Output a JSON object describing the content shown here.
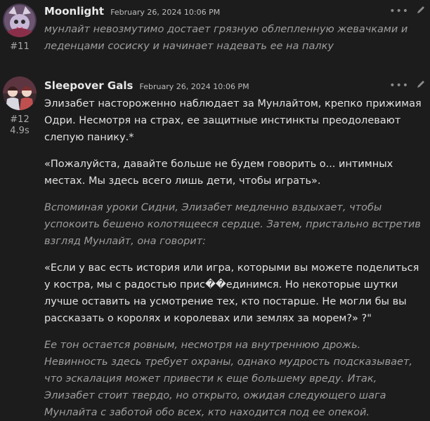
{
  "posts": [
    {
      "username": "Moonlight",
      "date": "February 26, 2024 10:06 PM",
      "post_number": "#11",
      "body": [
        "мунлайт невозмутимо достает грязную облепленную жевачками и леденцами сосиску и начинает надевать ее на палку"
      ]
    },
    {
      "username": "Sleepover Gals",
      "date": "February 26, 2024 10:06 PM",
      "post_number": "#12",
      "post_time": "4.9s",
      "body": [
        "Элизабет настороженно наблюдает за Мунлайтом, крепко прижимая Одри. Несмотря на страх, ее защитные инстинкты преодолевают слепую панику.*",
        "«Пожалуйста, давайте больше не будем говорить о... интимных местах. Мы здесь всего лишь дети, чтобы играть».",
        "Вспоминая уроки Сидни, Элизабет медленно вздыхает, чтобы успокоить бешено колотящееся сердце. Затем, пристально встретив взгляд Мунлайт, она говорит:",
        "«Если у вас есть история или игра, которыми вы можете поделиться у костра, мы с радостью прис��единимся. Но некоторые шутки лучше оставить на усмотрение тех, кто постарше. Не могли бы вы рассказать о королях и королевах или землях за морем?» ?\"",
        "Ее тон остается ровным, несмотря на внутреннюю дрожь. Невинность здесь требует охраны, однако мудрость подсказывает, что эскалация может привести к еще большему вреду. Итак, Элизабет стоит твердо, но открыто, ожидая следующего шага Мунлайта с заботой обо всех, кто находится под ее опекой."
      ]
    }
  ],
  "icons": {
    "more": "more-options-icon",
    "edit": "edit-pencil-icon"
  },
  "colors": {
    "background": "#1c1c1c",
    "italic_text": "#9e9e9e",
    "plain_text": "#e2e2e2"
  }
}
